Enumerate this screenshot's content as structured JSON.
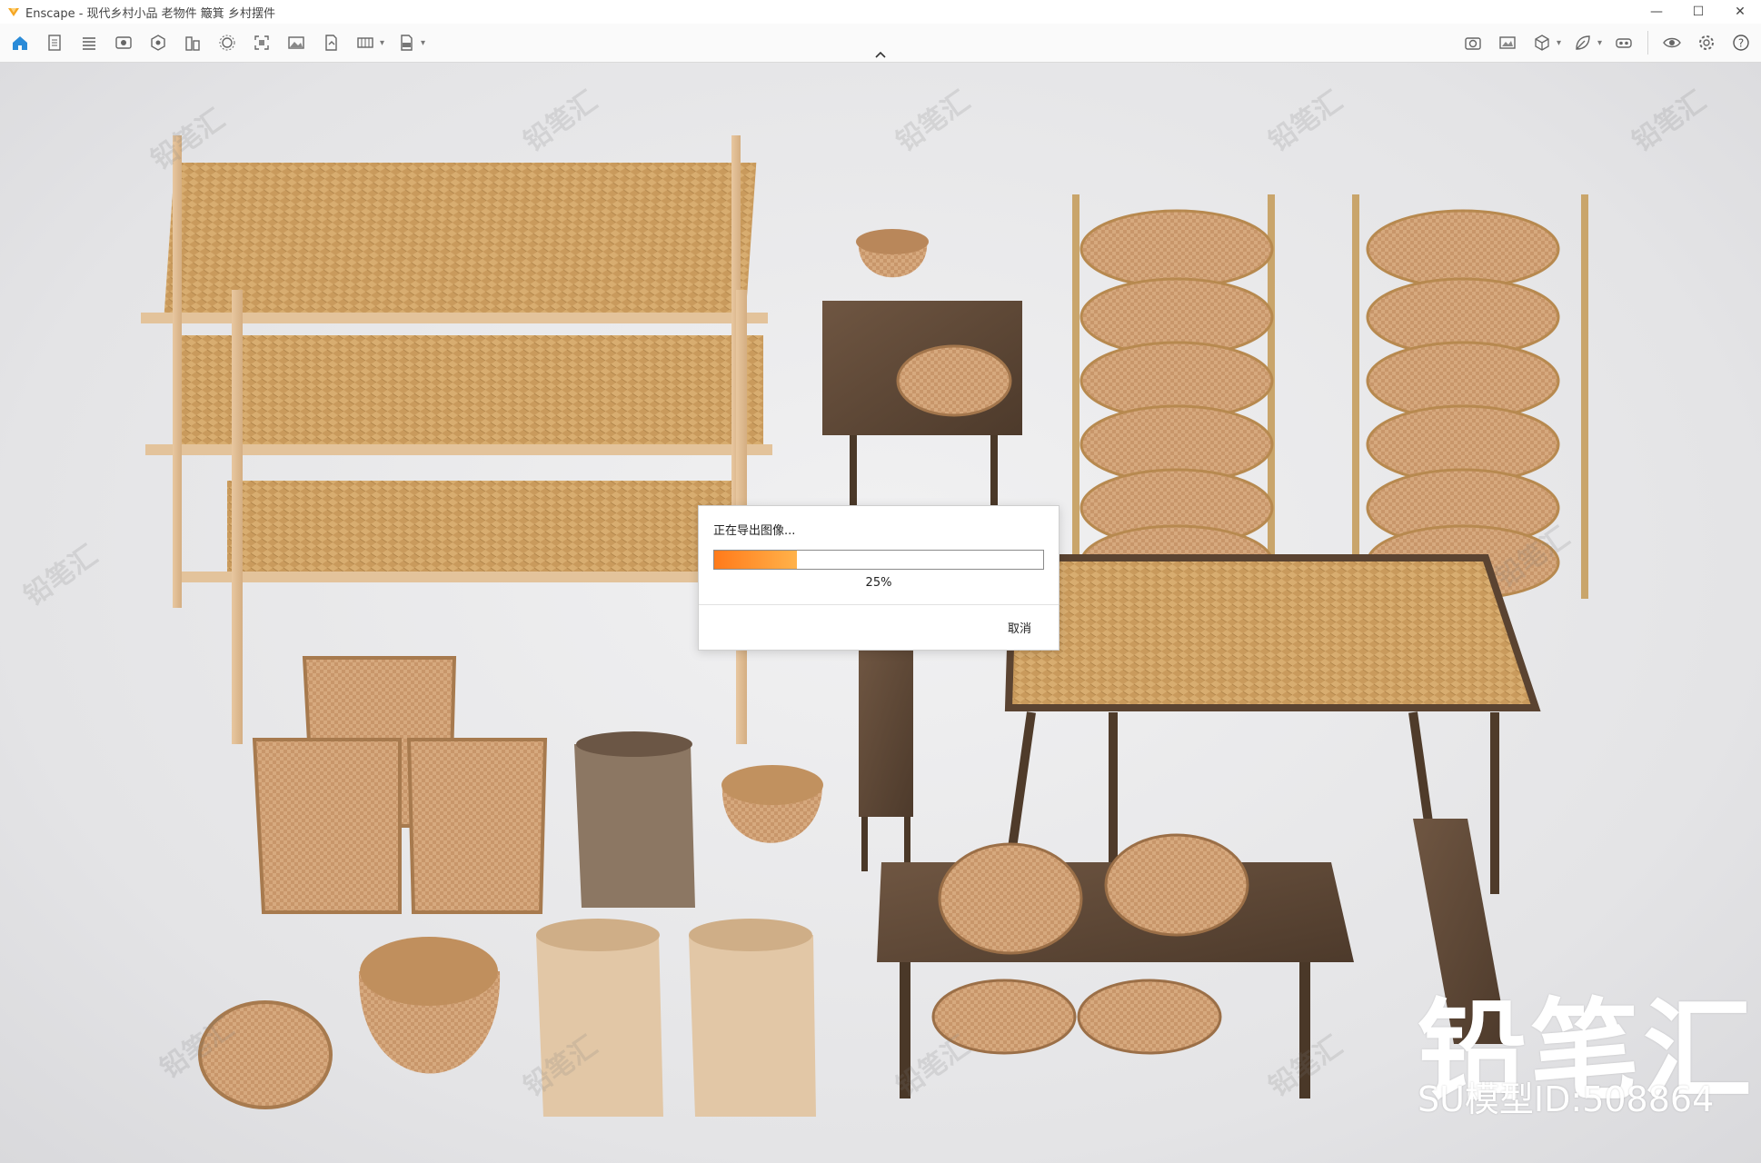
{
  "window": {
    "app_name": "Enscape",
    "title": "Enscape - 现代乡村小品 老物件 簸箕 乡村摆件",
    "controls": {
      "minimize": "—",
      "maximize": "☐",
      "close": "✕"
    }
  },
  "toolbar": {
    "left_icons": [
      "home-icon",
      "document-icon",
      "list-icon",
      "view-icon",
      "asset-icon",
      "building-icon",
      "sun-settings-icon",
      "capture-icon",
      "image-icon",
      "file-export-icon",
      "panorama-icon",
      "exe-export-icon"
    ],
    "right_icons": [
      "camera-icon",
      "screenshot-icon",
      "cube-icon",
      "leaf-icon",
      "vr-headset-icon",
      "eye-icon",
      "settings-icon",
      "help-icon"
    ]
  },
  "dialog": {
    "title": "正在导出图像...",
    "progress_percent": 25,
    "percent_label": "25%",
    "cancel_label": "取消"
  },
  "overlay": {
    "brand": "铅笔汇",
    "model_id": "SU模型ID:508864",
    "watermark": "铅笔汇"
  },
  "colors": {
    "accent": "#ff7a1a",
    "enscape_logo": "#f5a623",
    "home_active": "#2a8bd8"
  }
}
